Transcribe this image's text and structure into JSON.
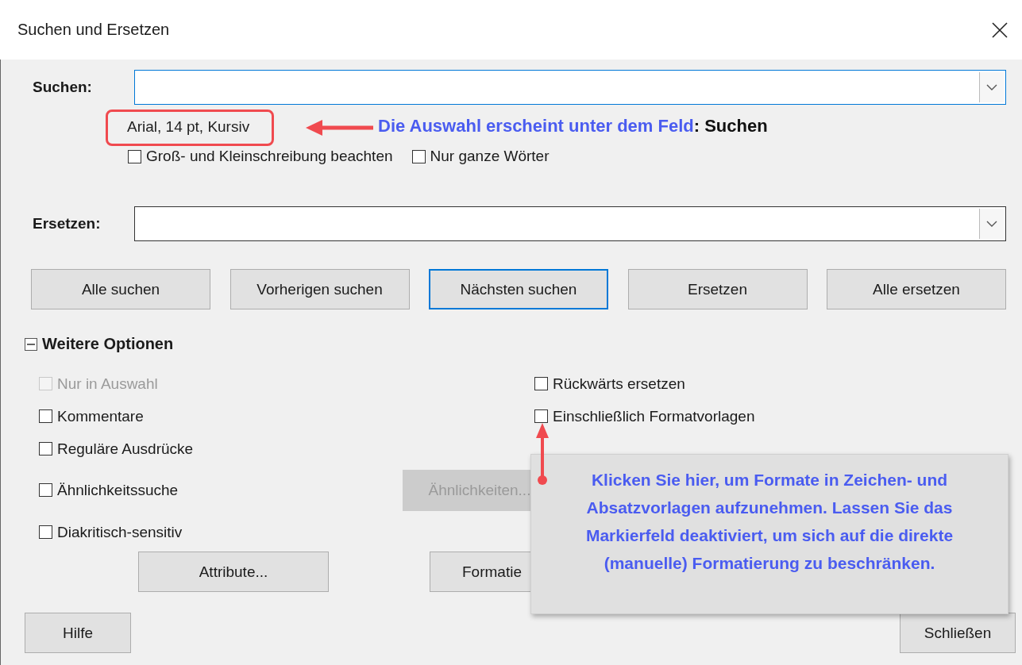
{
  "window": {
    "title": "Suchen und Ersetzen"
  },
  "search": {
    "label": "Suchen:",
    "focused": true,
    "format_summary": "Arial, 14 pt, Kursiv"
  },
  "search_options": [
    {
      "label": "Groß- und Kleinschreibung beachten",
      "checked": false
    },
    {
      "label": "Nur ganze Wörter",
      "checked": false
    }
  ],
  "replace": {
    "label": "Ersetzen:",
    "focused": false
  },
  "action_buttons": [
    {
      "label": "Alle suchen",
      "default": false
    },
    {
      "label": "Vorherigen suchen",
      "default": false
    },
    {
      "label": "Nächsten suchen",
      "default": true
    },
    {
      "label": "Ersetzen",
      "default": false
    },
    {
      "label": "Alle ersetzen",
      "default": false
    }
  ],
  "more_options": {
    "label": "Weitere Optionen",
    "expanded": true
  },
  "options_left": [
    {
      "label": "Nur in Auswahl",
      "checked": false,
      "disabled": true
    },
    {
      "label": "Kommentare",
      "checked": false,
      "disabled": false
    },
    {
      "label": "Reguläre Ausdrücke",
      "checked": false,
      "disabled": false
    },
    {
      "label": "Ähnlichkeitssuche",
      "checked": false,
      "disabled": false
    },
    {
      "label": "Diakritisch-sensitiv",
      "checked": false,
      "disabled": false
    }
  ],
  "options_right": [
    {
      "label": "Rückwärts ersetzen",
      "checked": false,
      "disabled": false
    },
    {
      "label": "Einschließlich Formatvorlagen",
      "checked": false,
      "disabled": false
    }
  ],
  "similarity_button": {
    "label": "Ähnlichkeiten...",
    "disabled": true
  },
  "format_buttons": [
    {
      "label": "Attribute...",
      "disabled": false
    },
    {
      "label": "Formatie",
      "disabled": false
    }
  ],
  "help_button": {
    "label": "Hilfe"
  },
  "close_button": {
    "label": "Schließen"
  },
  "annotations": {
    "search_note": "Die Auswahl erscheint unter dem Feld",
    "search_note_field": ": Suchen",
    "callout": "Klicken Sie hier, um Formate in Zeichen- und Absatzvorlagen aufzunehmen. Lassen Sie das Markierfeld deaktiviert, um sich auf die direkte (manuelle) Formatierung zu beschränken."
  }
}
